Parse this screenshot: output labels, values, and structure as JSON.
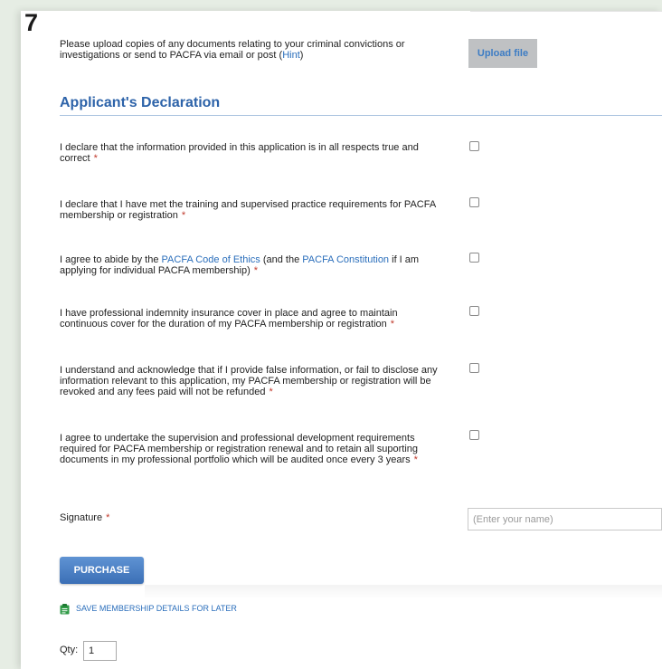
{
  "step": {
    "number": "7"
  },
  "upload": {
    "text_before_hint": "Please upload copies of any documents relating to your criminal convictions or investigations or send to PACFA via email or post (",
    "hint_link": "Hint",
    "text_after_hint": ")",
    "button_label": "Upload file"
  },
  "declaration": {
    "title": "Applicant's Declaration",
    "items": [
      {
        "text": "I declare that the information provided in this application is in all respects true and correct",
        "required_mark": "*"
      },
      {
        "text": "I declare that I have met the training and supervised practice requirements for PACFA membership or registration",
        "required_mark": "*"
      },
      {
        "text_part1": "I agree to abide by the ",
        "link1": "PACFA Code of Ethics",
        "text_part2": " (and the ",
        "link2": "PACFA Constitution",
        "text_part3": " if I am applying for individual PACFA membership)",
        "required_mark": "*"
      },
      {
        "text": "I have professional indemnity insurance cover in place and agree to maintain continuous cover for the duration of my PACFA membership or registration",
        "required_mark": "*"
      },
      {
        "text": "I understand and acknowledge that if I provide false information, or fail to disclose any information relevant to this application, my PACFA membership or registration will be revoked and any fees paid will not be refunded",
        "required_mark": "*"
      },
      {
        "text": "I agree to undertake the supervision and professional development requirements required for PACFA membership or registration renewal and to retain all suporting documents in my professional portfolio which will be audited once every 3 years",
        "required_mark": "*"
      }
    ]
  },
  "signature": {
    "label": "Signature",
    "required_mark": "*",
    "placeholder": "(Enter your name)"
  },
  "actions": {
    "purchase_label": "PURCHASE",
    "save_label": "SAVE MEMBERSHIP DETAILS FOR LATER",
    "save_icon": "clipboard-icon"
  },
  "quantity": {
    "label": "Qty:",
    "value": "1"
  },
  "colors": {
    "accent": "#2d63a9",
    "link": "#2a6ebb",
    "required": "#c0392b",
    "save_icon": "#2e9a45"
  }
}
